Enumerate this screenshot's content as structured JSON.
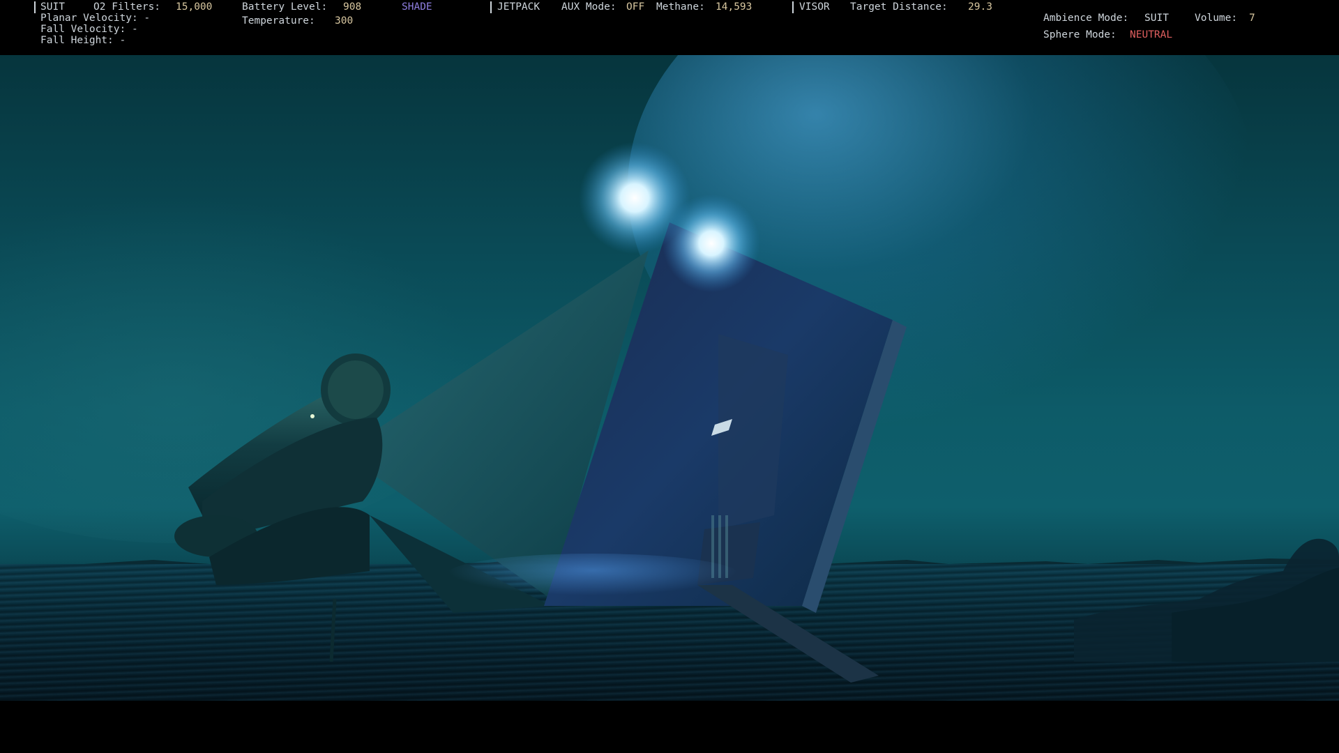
{
  "hud": {
    "suit": {
      "label": "SUIT",
      "o2_label": "O2 Filters:",
      "o2_value": "15,000",
      "planar_velocity": "Planar Velocity: -",
      "fall_velocity": "Fall Velocity: -",
      "fall_height": "Fall Height: -"
    },
    "battery": {
      "label": "Battery Level:",
      "value": "908",
      "temperature_label": "Temperature:",
      "temperature_value": "300",
      "shade": "SHADE"
    },
    "jetpack": {
      "label": "JETPACK",
      "aux_label": "AUX Mode:",
      "aux_value": "OFF",
      "methane_label": "Methane:",
      "methane_value": "14,593"
    },
    "visor": {
      "label": "VISOR",
      "target_label": "Target Distance:",
      "target_value": "29.3"
    },
    "ambience": {
      "label": "Ambience Mode:",
      "value": "SUIT",
      "volume_label": "Volume:",
      "volume_value": "7",
      "sphere_label": "Sphere Mode:",
      "sphere_value": "NEUTRAL"
    }
  },
  "colors": {
    "hud_text": "#cfd6dc",
    "hud_number": "#d8c7a0",
    "shade": "#8f7fe0",
    "neutral": "#e05f5f",
    "sky": "#0d5b68",
    "water": "#082c3a"
  }
}
